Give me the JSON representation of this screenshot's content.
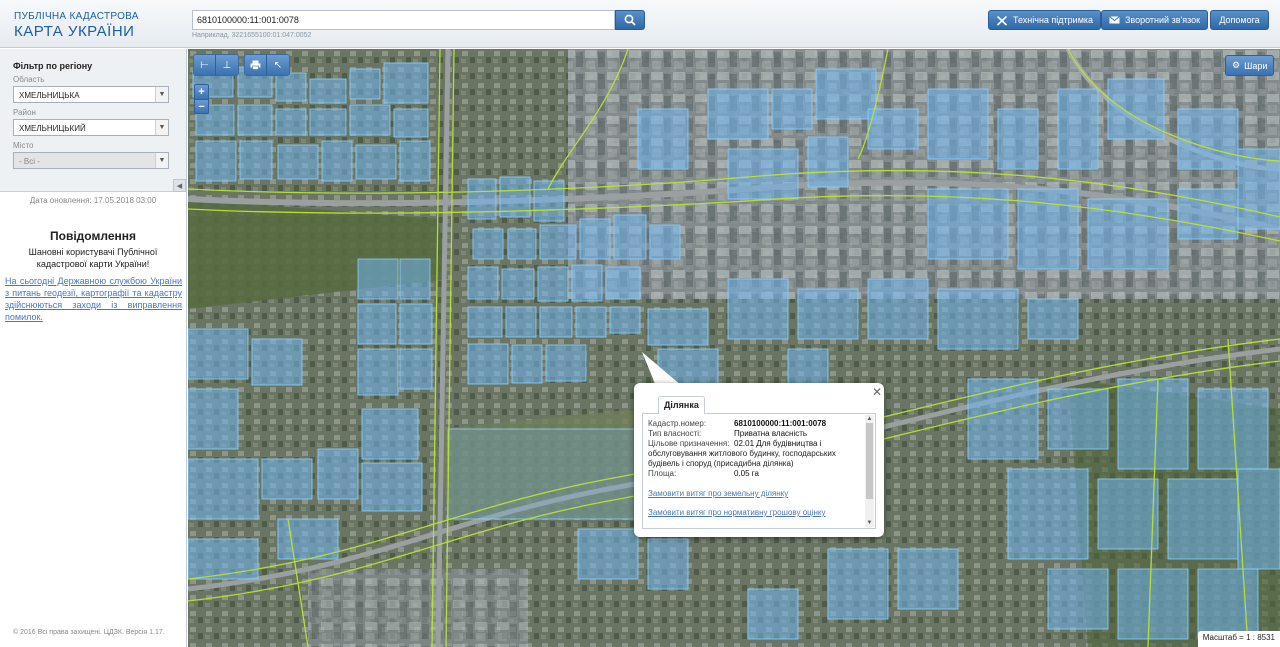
{
  "header": {
    "logo_line1": "ПУБЛІЧНА КАДАСТРОВА",
    "logo_line2": "КАРТА УКРАЇНИ",
    "search_value": "6810100000:11:001:0078",
    "search_hint": "Наприклад, 3221655100:01:047:0052",
    "buttons": {
      "support": "Технічна підтримка",
      "feedback": "Зворотний зв'язок",
      "help": "Допомога"
    }
  },
  "sidebar": {
    "filter_title": "Фільтр по регіону",
    "oblast_label": "Область",
    "oblast_value": "ХМЕЛЬНИЦЬКА",
    "rayon_label": "Район",
    "rayon_value": "ХМЕЛЬНИЦЬКИЙ",
    "city_label": "Місто",
    "city_value": "- Всі -",
    "update_date": "Дата оновлення: 17.05.2018 03:00",
    "notice_title": "Повідомлення",
    "notice_greeting": "Шановні користувачі Публічної кадастрової карти України!",
    "notice_link": "На сьогодні Державною службою України з питань геодезії, картографії та кадастру здійснюються заходи із виправлення помилок.",
    "copyright": "© 2016 Всі права захищені. ЦДЗК. Версія 1.17."
  },
  "map": {
    "layers_label": "Шари",
    "scale_text": "Масштаб = 1 : 8531",
    "icons": [
      "ruler-icon",
      "area-ruler-icon",
      "print-icon",
      "info-cursor-icon",
      "zoom-in-icon",
      "zoom-out-icon",
      "gear-icon"
    ]
  },
  "popup": {
    "tab_label": "Ділянка",
    "rows": [
      {
        "key": "Кадастр.номер:",
        "value": "6810100000:11:001:0078"
      },
      {
        "key": "Тип власності:",
        "value": "Приватна власність"
      },
      {
        "key": "Цільове призначення:",
        "value": "02.01 Для будівництва і"
      }
    ],
    "purpose_continuation": "обслуговування житлового будинку, господарських будівель і споруд (присадибна ділянка)",
    "area_key": "Площа:",
    "area_value": "0.05 га",
    "link_extract": "Замовити витяг про земельну ділянку",
    "link_valuation": "Замовити витяг про нормативну грошову оцінку"
  },
  "colors": {
    "brand_blue": "#1d5fa3",
    "button_blue": "#3a72b0",
    "parcel_fill": "#6fb4ee",
    "parcel_stroke": "#8fd0ff",
    "boundary_line": "#b9e23a"
  }
}
